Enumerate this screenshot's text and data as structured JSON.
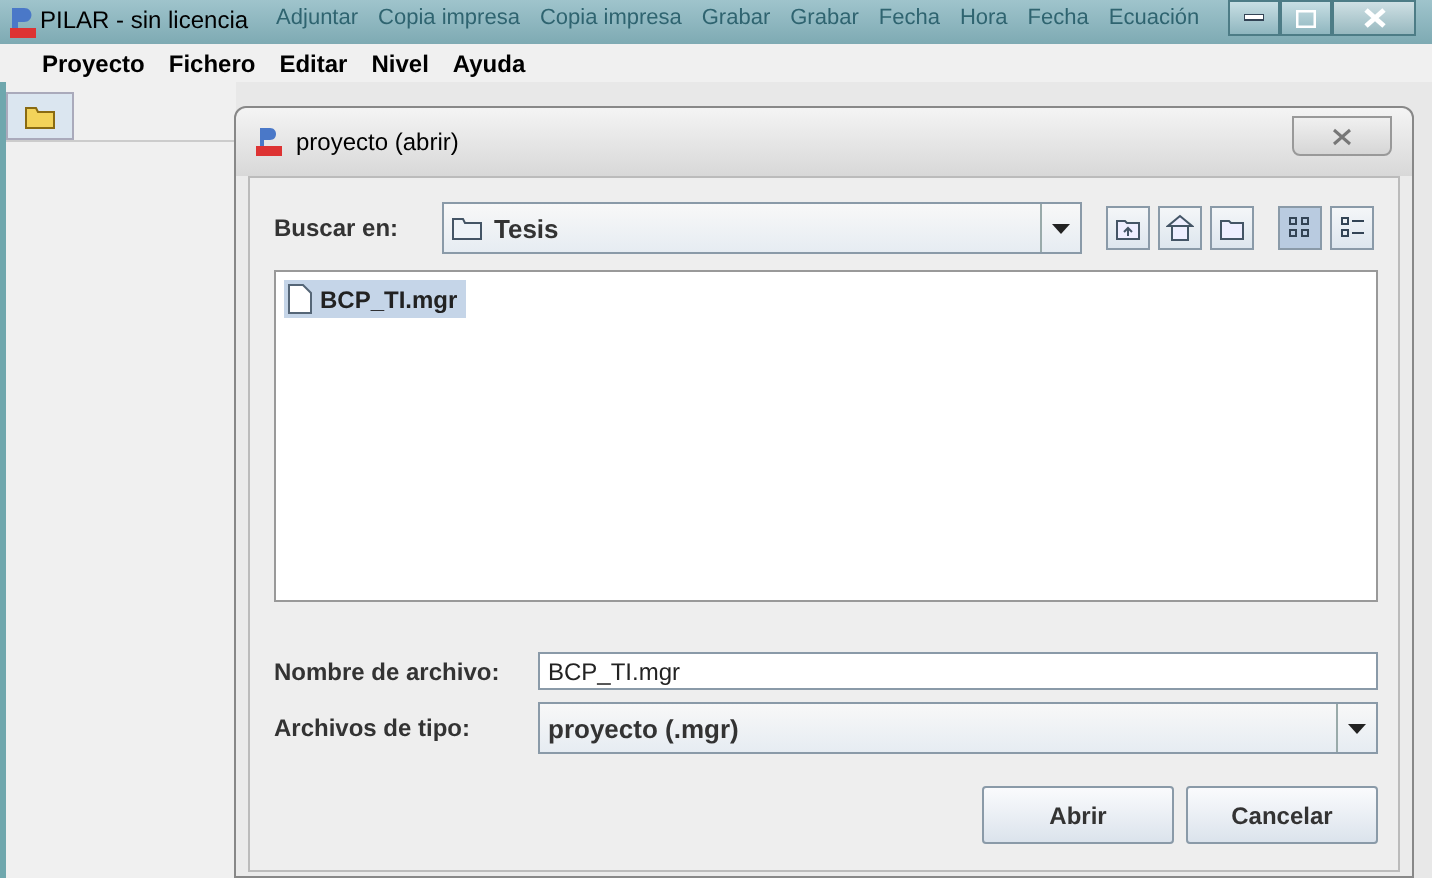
{
  "window": {
    "title": "PILAR - sin licencia"
  },
  "ribbon_ghost": {
    "top": [
      "Adjuntar",
      "Copia impresa",
      "Copia impresa",
      "Grabar",
      "Grabar",
      "Fecha",
      "Hora",
      "Fecha",
      "Ecuación"
    ]
  },
  "menu": [
    "Proyecto",
    "Fichero",
    "Editar",
    "Nivel",
    "Ayuda"
  ],
  "dialog": {
    "title": "proyecto (abrir)",
    "look_in": {
      "label": "Buscar en:",
      "value": "Tesis"
    },
    "view_buttons": [
      {
        "kind": "up",
        "selected": false
      },
      {
        "kind": "home",
        "selected": false
      },
      {
        "kind": "newfolder",
        "selected": false
      },
      {
        "kind": "list",
        "selected": true
      },
      {
        "kind": "details",
        "selected": false
      }
    ],
    "files": [
      {
        "name": "BCP_TI.mgr",
        "selected": true
      }
    ],
    "file_name": {
      "label": "Nombre de archivo:",
      "value": "BCP_TI.mgr"
    },
    "file_type": {
      "label": "Archivos de tipo:",
      "value": "proyecto (.mgr)"
    },
    "buttons": [
      "Abrir",
      "Cancelar"
    ]
  }
}
